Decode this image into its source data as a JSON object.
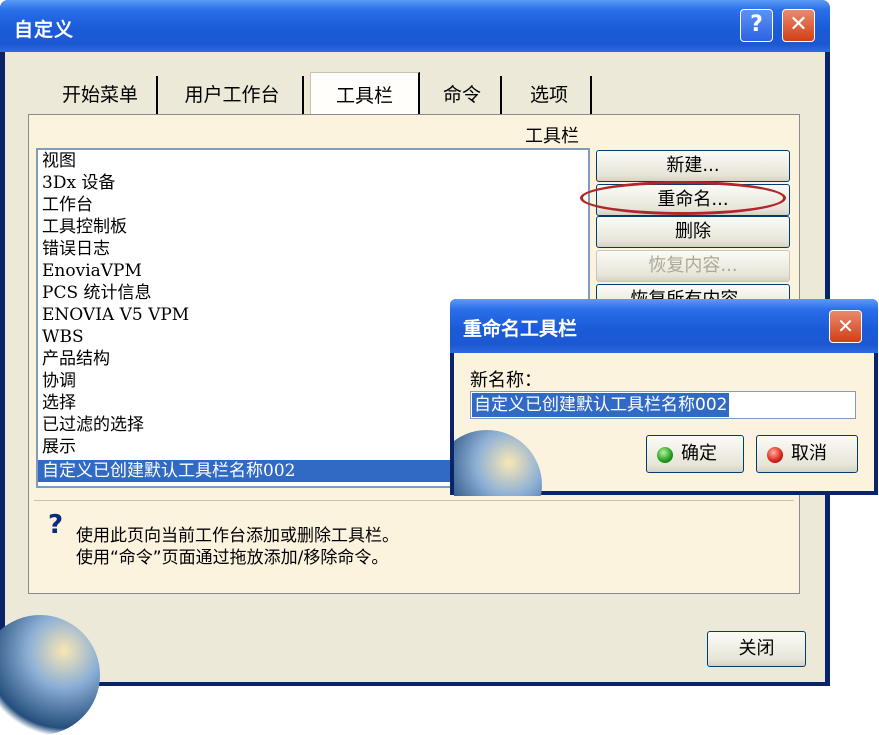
{
  "window": {
    "title": "自定义",
    "help_glyph": "?",
    "close_glyph": "✕"
  },
  "tabs": [
    {
      "label": "开始菜单"
    },
    {
      "label": "用户工作台"
    },
    {
      "label": "工具栏"
    },
    {
      "label": "命令"
    },
    {
      "label": "选项"
    }
  ],
  "toolbars_group": {
    "label": "工具栏",
    "items": [
      "视图",
      "3Dx 设备",
      "工作台",
      "工具控制板",
      "错误日志",
      "EnoviaVPM",
      "PCS 统计信息",
      "ENOVIA V5 VPM",
      "WBS",
      "产品结构",
      "协调",
      "选择",
      "已过滤的选择",
      "展示",
      "自定义已创建默认工具栏名称002"
    ],
    "selected_index": 14
  },
  "side_buttons": {
    "new": "新建...",
    "rename": "重命名...",
    "delete": "删除",
    "restore": "恢复内容...",
    "restore_all": "恢复所有内容..."
  },
  "hint": {
    "line1": "使用此页向当前工作台添加或删除工具栏。",
    "line2": "使用“命令”页面通过拖放添加/移除命令。"
  },
  "close_button": "关闭",
  "rename_dialog": {
    "title": "重命名工具栏",
    "close_glyph": "✕",
    "field_label": "新名称：",
    "field_value": "自定义已创建默认工具栏名称002",
    "ok": "确定",
    "cancel": "取消"
  },
  "colors": {
    "titlebar": "#1b5bd8",
    "selection": "#316ac5",
    "highlight_ellipse": "#b0272a"
  }
}
